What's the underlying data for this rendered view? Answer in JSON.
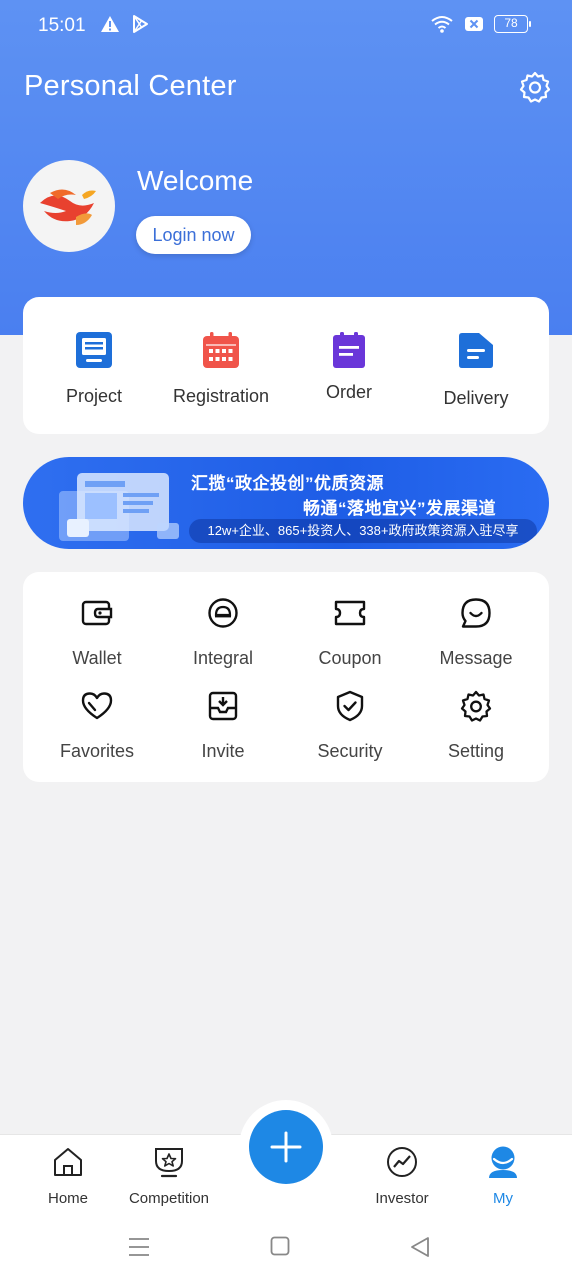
{
  "status_bar": {
    "time": "15:01",
    "battery": "78"
  },
  "header": {
    "title": "Personal Center"
  },
  "profile": {
    "welcome": "Welcome",
    "login_label": "Login now"
  },
  "quick_entries": [
    {
      "label": "Project",
      "icon": "project-icon",
      "color": "#1e6fd9"
    },
    {
      "label": "Registration",
      "icon": "calendar-icon",
      "color": "#f0544a"
    },
    {
      "label": "Order",
      "icon": "clipboard-icon",
      "color": "#6a36d9"
    },
    {
      "label": "Delivery",
      "icon": "folder-icon",
      "color": "#1e6fd9"
    }
  ],
  "banner": {
    "line1": "汇揽“政企投创”优质资源",
    "line2": "畅通“落地宜兴”发展渠道",
    "line3": "12w+企业、865+投资人、338+政府政策资源入驻尽享"
  },
  "services": [
    {
      "label": "Wallet",
      "icon": "wallet-icon"
    },
    {
      "label": "Integral",
      "icon": "integral-icon"
    },
    {
      "label": "Coupon",
      "icon": "coupon-icon"
    },
    {
      "label": "Message",
      "icon": "message-icon"
    },
    {
      "label": "Favorites",
      "icon": "heart-icon"
    },
    {
      "label": "Invite",
      "icon": "invite-icon"
    },
    {
      "label": "Security",
      "icon": "shield-icon"
    },
    {
      "label": "Setting",
      "icon": "gear-icon"
    }
  ],
  "bottom_nav": [
    {
      "label": "Home",
      "icon": "home-icon"
    },
    {
      "label": "Competition",
      "icon": "trophy-icon"
    },
    {
      "label": "Investor",
      "icon": "chart-icon"
    },
    {
      "label": "My",
      "icon": "user-icon",
      "active": true
    }
  ],
  "colors": {
    "hero": "#4f85f1",
    "accent": "#1e88e5"
  }
}
